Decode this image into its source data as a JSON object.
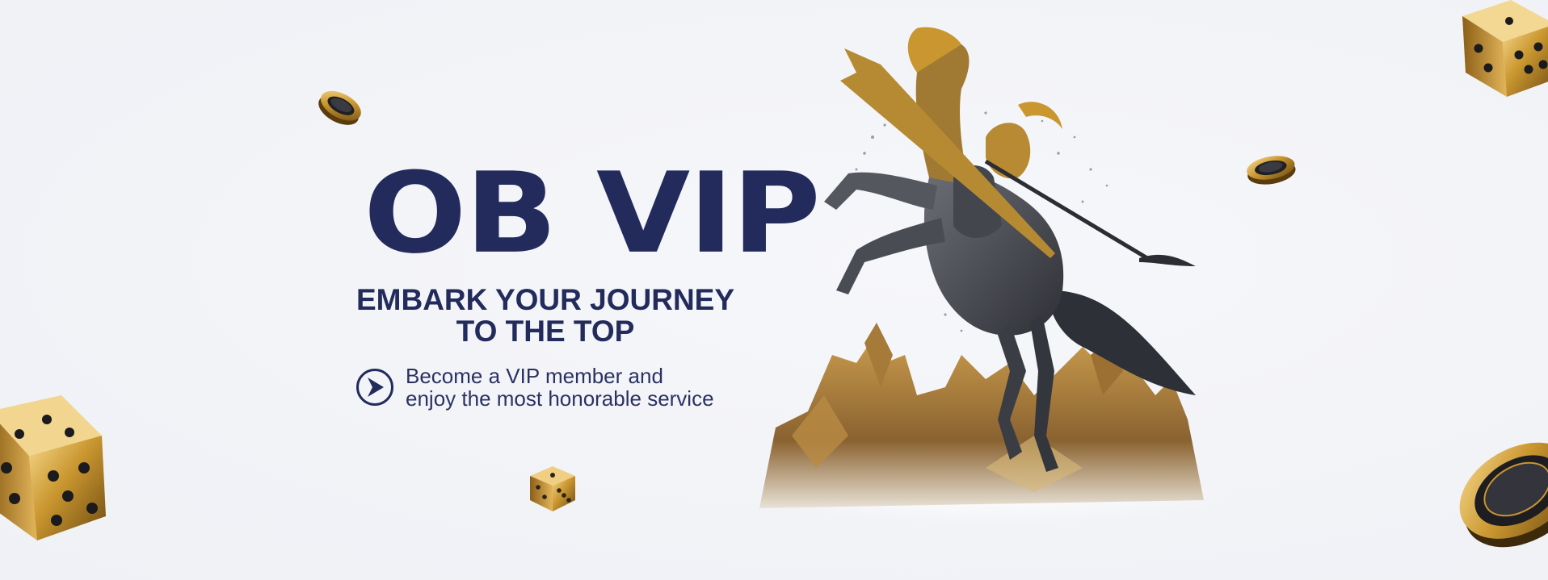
{
  "banner": {
    "title": "OB VIP",
    "subtitle_line1": "EMBARK YOUR JOURNEY",
    "subtitle_line2": "TO THE TOP",
    "cta_line1": "Become a VIP member and",
    "cta_line2": "enjoy the most honorable service",
    "cta_icon": "arrow-right-circle-icon"
  },
  "theme": {
    "navy": "#222b5b",
    "gold": "#c9962f",
    "background": "#f3f4f8"
  },
  "decorations": [
    "gold-dice-icon",
    "gold-poker-chip-icon",
    "knight-on-rearing-horse-statue",
    "gold-rock-base"
  ]
}
